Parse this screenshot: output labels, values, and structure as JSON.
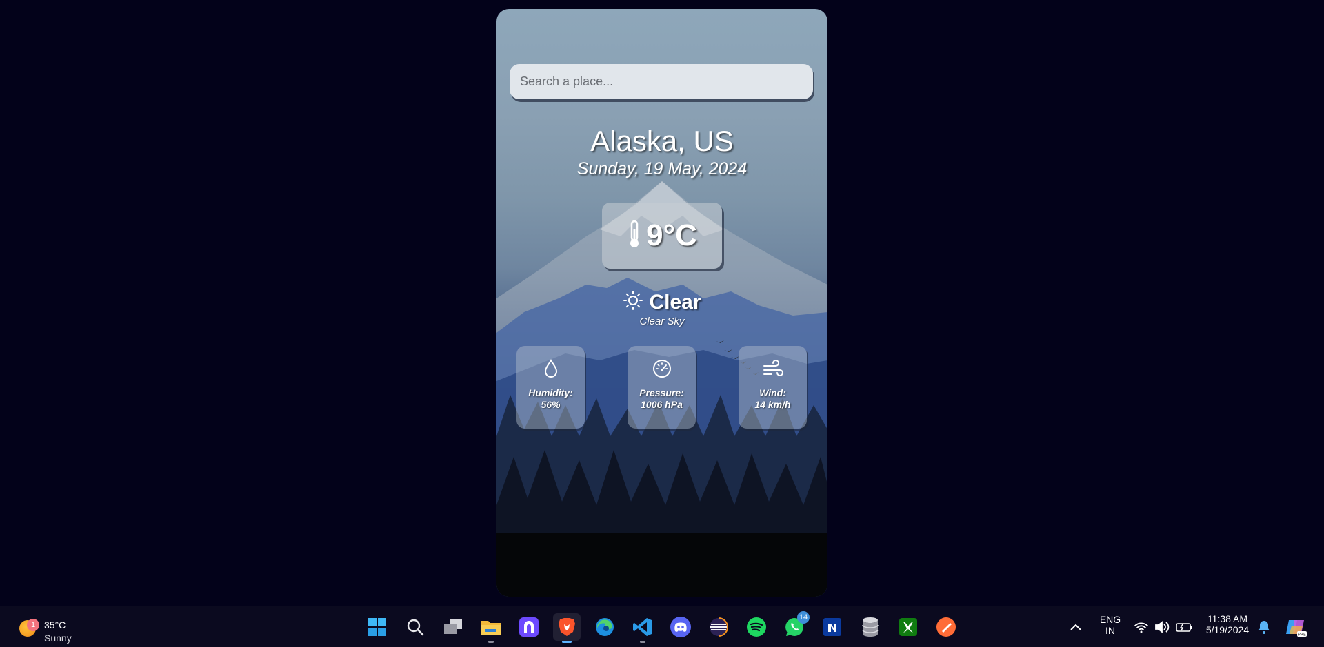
{
  "search": {
    "placeholder": "Search a place..."
  },
  "location": {
    "city": "Alaska, US",
    "date": "Sunday, 19 May, 2024"
  },
  "current": {
    "temperature": "9°C",
    "condition": "Clear",
    "description": "Clear Sky",
    "condition_icon": "sun-icon",
    "temperature_icon": "thermometer-icon"
  },
  "stats": [
    {
      "label": "Humidity:",
      "value": "56%",
      "icon": "droplet-icon"
    },
    {
      "label": "Pressure:",
      "value": "1006 hPa",
      "icon": "gauge-icon"
    },
    {
      "label": "Wind:",
      "value": "14 km/h",
      "icon": "wind-icon"
    }
  ],
  "taskbar": {
    "weather": {
      "temp": "35°C",
      "condition": "Sunny",
      "badge": "1"
    },
    "apps": [
      {
        "name": "start",
        "icon": "windows-icon"
      },
      {
        "name": "search",
        "icon": "search-icon"
      },
      {
        "name": "task-view",
        "icon": "task-view-icon"
      },
      {
        "name": "file-explorer",
        "icon": "folder-icon"
      },
      {
        "name": "proton-vpn",
        "icon": "vpn-icon"
      },
      {
        "name": "brave",
        "icon": "brave-icon"
      },
      {
        "name": "edge",
        "icon": "edge-icon"
      },
      {
        "name": "vscode",
        "icon": "vscode-icon"
      },
      {
        "name": "discord",
        "icon": "discord-icon"
      },
      {
        "name": "eclipse",
        "icon": "eclipse-icon"
      },
      {
        "name": "spotify",
        "icon": "spotify-icon"
      },
      {
        "name": "whatsapp",
        "icon": "whatsapp-icon",
        "badge": "14"
      },
      {
        "name": "notion",
        "icon": "notion-icon"
      },
      {
        "name": "database",
        "icon": "database-icon"
      },
      {
        "name": "xbox",
        "icon": "xbox-icon"
      },
      {
        "name": "postman",
        "icon": "postman-icon"
      }
    ],
    "tray": {
      "language": "ENG",
      "region": "IN",
      "time": "11:38 AM",
      "date": "5/19/2024"
    }
  },
  "colors": {
    "desktop_bg": "#03021a",
    "taskbar_bg": "#0b0a1f",
    "card_top": "#8ea7ba",
    "card_bottom": "#050608"
  }
}
